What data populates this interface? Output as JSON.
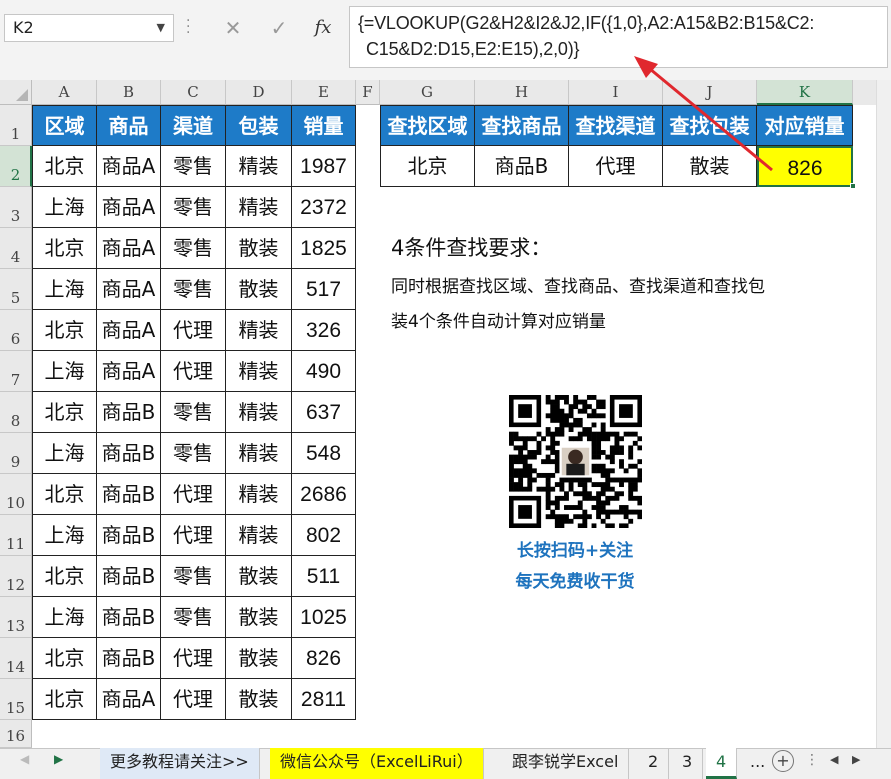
{
  "formula_bar": {
    "name_box": "K2",
    "formula_line1": "{=VLOOKUP(G2&H2&I2&J2,IF({1,0},A2:A15&B2:B15&C2:",
    "formula_line2": "C15&D2:D15,E2:E15),2,0)}",
    "cancel_icon": "✕",
    "enter_icon": "✓",
    "fx_label": "fx"
  },
  "columns": [
    "A",
    "B",
    "C",
    "D",
    "E",
    "F",
    "G",
    "H",
    "I",
    "J",
    "K"
  ],
  "rows": [
    "1",
    "2",
    "3",
    "4",
    "5",
    "6",
    "7",
    "8",
    "9",
    "10",
    "11",
    "12",
    "13",
    "14",
    "15",
    "16"
  ],
  "table": {
    "headers": [
      "区域",
      "商品",
      "渠道",
      "包装",
      "销量"
    ],
    "rows": [
      [
        "北京",
        "商品A",
        "零售",
        "精装",
        "1987"
      ],
      [
        "上海",
        "商品A",
        "零售",
        "精装",
        "2372"
      ],
      [
        "北京",
        "商品A",
        "零售",
        "散装",
        "1825"
      ],
      [
        "上海",
        "商品A",
        "零售",
        "散装",
        "517"
      ],
      [
        "北京",
        "商品A",
        "代理",
        "精装",
        "326"
      ],
      [
        "上海",
        "商品A",
        "代理",
        "精装",
        "490"
      ],
      [
        "北京",
        "商品B",
        "零售",
        "精装",
        "637"
      ],
      [
        "上海",
        "商品B",
        "零售",
        "精装",
        "548"
      ],
      [
        "北京",
        "商品B",
        "代理",
        "精装",
        "2686"
      ],
      [
        "上海",
        "商品B",
        "代理",
        "精装",
        "802"
      ],
      [
        "北京",
        "商品B",
        "零售",
        "散装",
        "511"
      ],
      [
        "上海",
        "商品B",
        "零售",
        "散装",
        "1025"
      ],
      [
        "北京",
        "商品B",
        "代理",
        "散装",
        "826"
      ],
      [
        "北京",
        "商品A",
        "代理",
        "散装",
        "2811"
      ]
    ]
  },
  "lookup": {
    "headers": [
      "查找区域",
      "查找商品",
      "查找渠道",
      "查找包装",
      "对应销量"
    ],
    "values": [
      "北京",
      "商品B",
      "代理",
      "散装",
      "826"
    ],
    "highlight_color": "#ffff00"
  },
  "notes": {
    "title": "4条件查找要求：",
    "line1": "同时根据查找区域、查找商品、查找渠道和查找包",
    "line2": "装4个条件自动计算对应销量"
  },
  "qr": {
    "caption1": "长按扫码+关注",
    "caption2": "每天免费收干货"
  },
  "sheet_tabs": [
    "更多教程请关注>>",
    "微信公众号（ExcelLiRui）",
    "跟李锐学Excel",
    "2",
    "3",
    "4",
    "..."
  ],
  "colors": {
    "header_blue": "#1e7bc8",
    "accent_green": "#217346",
    "arrow_red": "#e0282e"
  }
}
